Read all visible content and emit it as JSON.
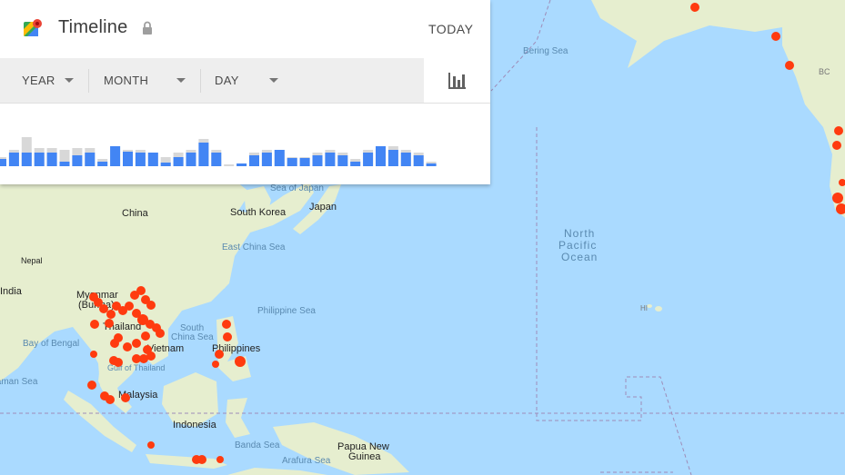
{
  "app": {
    "title": "Timeline",
    "today_label": "TODAY"
  },
  "filters": {
    "year_label": "YEAR",
    "month_label": "MONTH",
    "day_label": "DAY"
  },
  "icons": {
    "logo": "google-maps-pin-icon",
    "lock": "lock-icon",
    "chart": "bar-chart-icon",
    "dropdown": "caret-down-icon"
  },
  "colors": {
    "water": "#aadaff",
    "land": "#e6eecf",
    "bar_active": "#4285f4",
    "bar_total": "#d8d8d8",
    "visit_dot": "#ff3b0f"
  },
  "map_labels": {
    "bering_sea": "Bering Sea",
    "bc": "BC",
    "sea_of_japan": "Sea of Japan",
    "south_korea": "South Korea",
    "japan": "Japan",
    "china": "China",
    "east_china_sea": "East China Sea",
    "nepal": "Nepal",
    "india": "India",
    "myanmar": "Myanmar",
    "burma": "(Burma)",
    "thailand": "Thailand",
    "vietnam": "Vietnam",
    "gulf_of_thailand": "Gulf of Thailand",
    "south_china_sea_1": "South",
    "south_china_sea_2": "China Sea",
    "philippine_sea": "Philippine Sea",
    "philippines": "Philippines",
    "bay_of_bengal": "Bay of Bengal",
    "andaman_sea": "Andaman Sea",
    "malaysia": "Malaysia",
    "indonesia": "Indonesia",
    "banda_sea": "Banda Sea",
    "arafura_sea": "Arafura Sea",
    "papua_new_guinea_1": "Papua New",
    "papua_new_guinea_2": "Guinea",
    "north_pacific_1": "North",
    "north_pacific_2": "Pacific",
    "north_pacific_3": "Ocean",
    "hi": "HI"
  },
  "chart_data": {
    "type": "bar",
    "series": [
      {
        "values": [
          8,
          15,
          15,
          15,
          15,
          5,
          12,
          15,
          5,
          22,
          16,
          15,
          15,
          4,
          10,
          15,
          26,
          15,
          0,
          3,
          12,
          15,
          18,
          9,
          9,
          12,
          15,
          12,
          5,
          15,
          22,
          18,
          15,
          12,
          3
        ]
      },
      {
        "values": [
          10,
          18,
          32,
          20,
          20,
          18,
          20,
          20,
          8,
          22,
          18,
          18,
          15,
          10,
          15,
          18,
          30,
          18,
          2,
          3,
          15,
          18,
          18,
          10,
          10,
          15,
          18,
          15,
          8,
          18,
          22,
          22,
          18,
          15,
          5
        ]
      }
    ]
  }
}
